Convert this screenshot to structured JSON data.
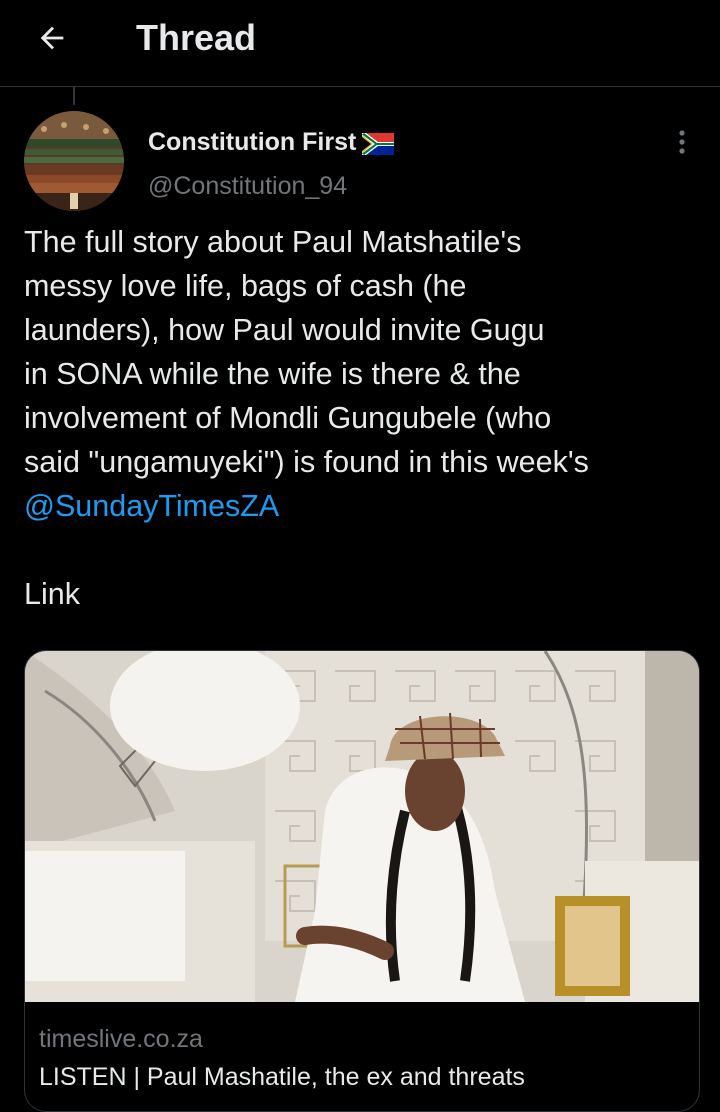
{
  "header": {
    "title": "Thread",
    "back_icon": "arrow-left-icon"
  },
  "tweet": {
    "author": {
      "display_name": "Constitution First",
      "handle": "@Constitution_94",
      "badge_icon": "south-africa-flag-icon"
    },
    "text_lines": [
      "The full story about Paul Matshatile's",
      "messy love life, bags of cash (he",
      "launders), how Paul would invite Gugu",
      "in SONA while the wife is there & the",
      "involvement of Mondli Gungubele (who",
      "said \"ungamuyeki\") is found in this week's"
    ],
    "mention": "@SundayTimesZA",
    "link_word": "Link",
    "more_icon": "more-vertical-icon"
  },
  "card": {
    "domain": "timeslive.co.za",
    "title": "LISTEN | Paul Mashatile, the ex and threats"
  },
  "colors": {
    "background": "#000000",
    "text": "#e7e9ea",
    "secondary": "#71767b",
    "link": "#1d9bf0",
    "divider": "#2f3336"
  }
}
